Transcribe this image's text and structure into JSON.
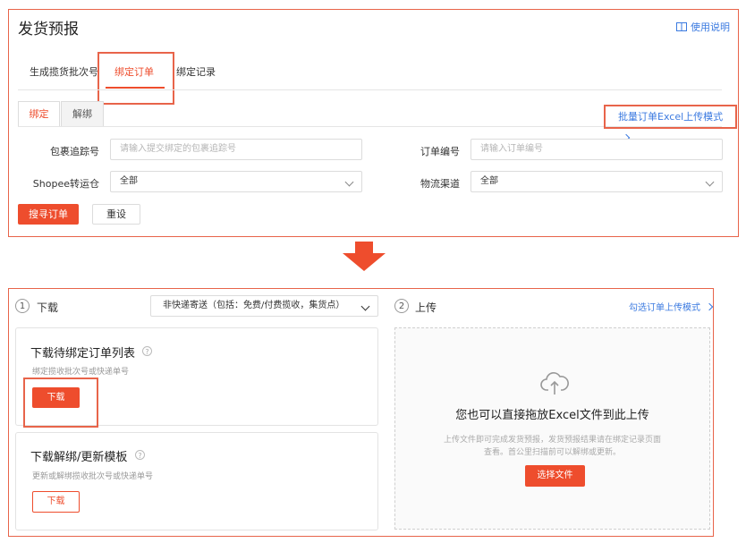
{
  "page": {
    "title": "发货预报",
    "help_link": "使用说明",
    "icons": {
      "help": "book-icon",
      "upload": "cloud-upload-icon",
      "question": "question-circle-icon",
      "chevron": "chevron-down-icon",
      "arrow": "arrow-down-icon"
    }
  },
  "tabs": [
    {
      "label": "生成揽货批次号"
    },
    {
      "label": "绑定订单",
      "active": true
    },
    {
      "label": "绑定记录"
    }
  ],
  "subtabs": [
    {
      "label": "绑定",
      "active": true
    },
    {
      "label": "解绑"
    }
  ],
  "batch_link": "批量订单Excel上传模式",
  "form": {
    "tracking_label": "包裹追踪号",
    "tracking_placeholder": "请输入提交绑定的包裹追踪号",
    "order_label": "订单编号",
    "order_placeholder": "请输入订单编号",
    "warehouse_label": "Shopee转运仓",
    "warehouse_value": "全部",
    "channel_label": "物流渠道",
    "channel_value": "全部",
    "search_button": "搜寻订单",
    "reset_button": "重设"
  },
  "steps": {
    "download": {
      "number": "1",
      "label": "下载"
    },
    "upload": {
      "number": "2",
      "label": "上传"
    },
    "shipping_select": "非快递寄送（包括：免费/付费揽收，集货点）",
    "select_link": "勾选订单上传模式"
  },
  "download_cards": [
    {
      "title": "下载待绑定订单列表",
      "desc": "绑定揽收批次号或快递单号",
      "button": "下载"
    },
    {
      "title": "下载解绑/更新模板",
      "desc": "更新或解绑揽收批次号或快递单号",
      "button": "下载"
    }
  ],
  "upload_area": {
    "title": "您也可以直接拖放Excel文件到此上传",
    "desc_line1": "上传文件即可完成发货预报，发货预报结果请在绑定记录页面",
    "desc_line2": "查看。首公里扫描前可以解绑或更新。",
    "button": "选择文件"
  },
  "colors": {
    "accent": "#ee4d2d",
    "link": "#3b7ae0",
    "highlight_border": "#e8644a"
  }
}
